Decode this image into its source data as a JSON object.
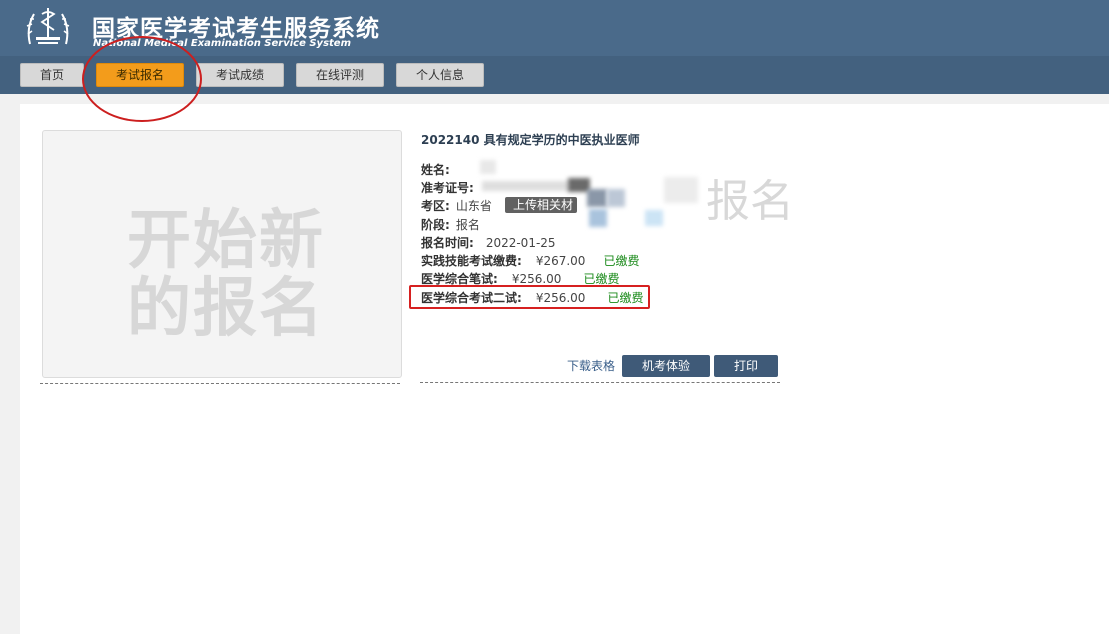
{
  "header": {
    "title_cn": "国家医学考试考生服务系统",
    "title_en": "National Medical Examination Service System",
    "logo_icon": "caduceus-logo-icon"
  },
  "nav": {
    "items": [
      {
        "label": "首页"
      },
      {
        "label": "考试报名",
        "active": true
      },
      {
        "label": "考试成绩"
      },
      {
        "label": "在线评测"
      },
      {
        "label": "个人信息"
      }
    ]
  },
  "new_registration": {
    "line1": "开始新",
    "line2": "的报名"
  },
  "exam": {
    "title": "2022140 具有规定学历的中医执业医师",
    "name_label": "姓名:",
    "ticket_label": "准考证号:",
    "region_label": "考区:",
    "region_value": "山东省",
    "upload_label": "上传相关材",
    "stage_label": "阶段:",
    "stage_value": "报名",
    "reg_time_label": "报名时间:",
    "reg_time_value": "2022-01-25",
    "fees": [
      {
        "label": "实践技能考试缴费:",
        "amount": "¥267.00",
        "status": "已缴费"
      },
      {
        "label": "医学综合笔试:",
        "amount": "¥256.00",
        "status": "已缴费"
      },
      {
        "label": "医学综合考试二试:",
        "amount": "¥256.00",
        "status": "已缴费"
      }
    ],
    "ghost_text": "报名"
  },
  "actions": {
    "download": "下载表格",
    "machine_exam": "机考体验",
    "print": "打印"
  },
  "colors": {
    "header_bg": "#4a6a8a",
    "nav_bg": "#43617f",
    "active_tab": "#f39c1b",
    "paid_green": "#1a8a1a",
    "highlight_red": "#d62020"
  }
}
